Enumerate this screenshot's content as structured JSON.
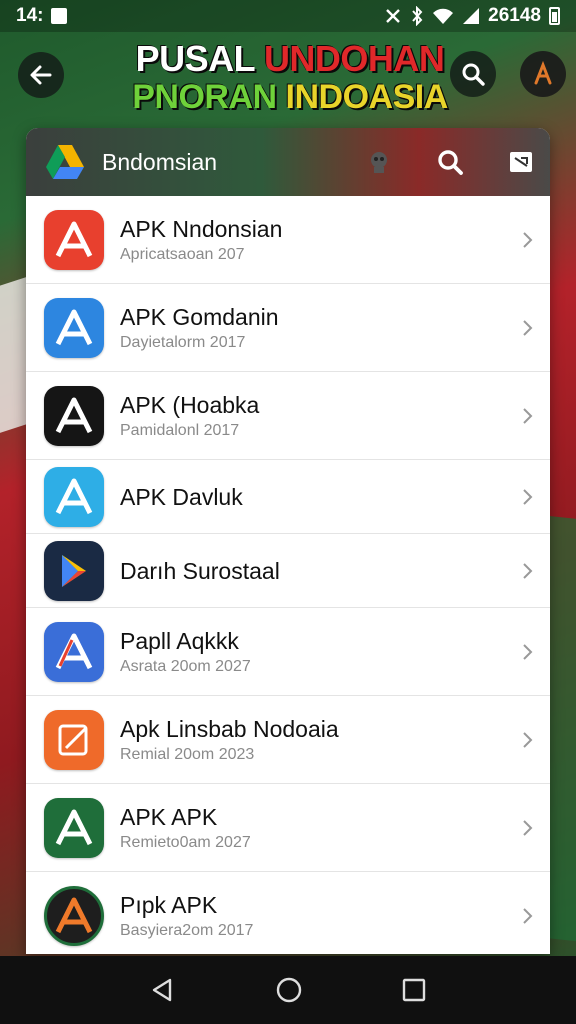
{
  "status_bar": {
    "time": "14:",
    "right_text": "26148"
  },
  "header": {
    "title_line1_white": "PUSAL ",
    "title_line1_red": "UNDOHAN",
    "title_line2_green": "PNORAN ",
    "title_line2_yellow": "INDOASIA"
  },
  "card": {
    "title": "Bndomsian"
  },
  "apps": [
    {
      "name": "APK Nndonsian",
      "sub": "Apricatsaoan 207",
      "color": "#e8402e"
    },
    {
      "name": "APK Gomdanin",
      "sub": "Dayietalorm 2017",
      "color": "#2d86e0"
    },
    {
      "name": "APK (Hoabka",
      "sub": "Pamidalonl 2017",
      "color": "#151515"
    },
    {
      "name": "APK Davluk",
      "sub": "",
      "color": "#2eaee6"
    },
    {
      "name": "Darıh Surostaal",
      "sub": "",
      "color": "#1a2a44"
    },
    {
      "name": "Papll Aqkkk",
      "sub": "Asrata 20om 2027",
      "color": "#3a6ed8"
    },
    {
      "name": "Apk Linsbab Nodoaia",
      "sub": "Remial 20om 2023",
      "color": "#ef6a2a"
    },
    {
      "name": "APK APK",
      "sub": "Remieto0am 2027",
      "color": "#1f6e3a"
    },
    {
      "name": "Pıpk APK",
      "sub": "Basyiera2om 2017",
      "color": "#1e1e1e"
    }
  ]
}
